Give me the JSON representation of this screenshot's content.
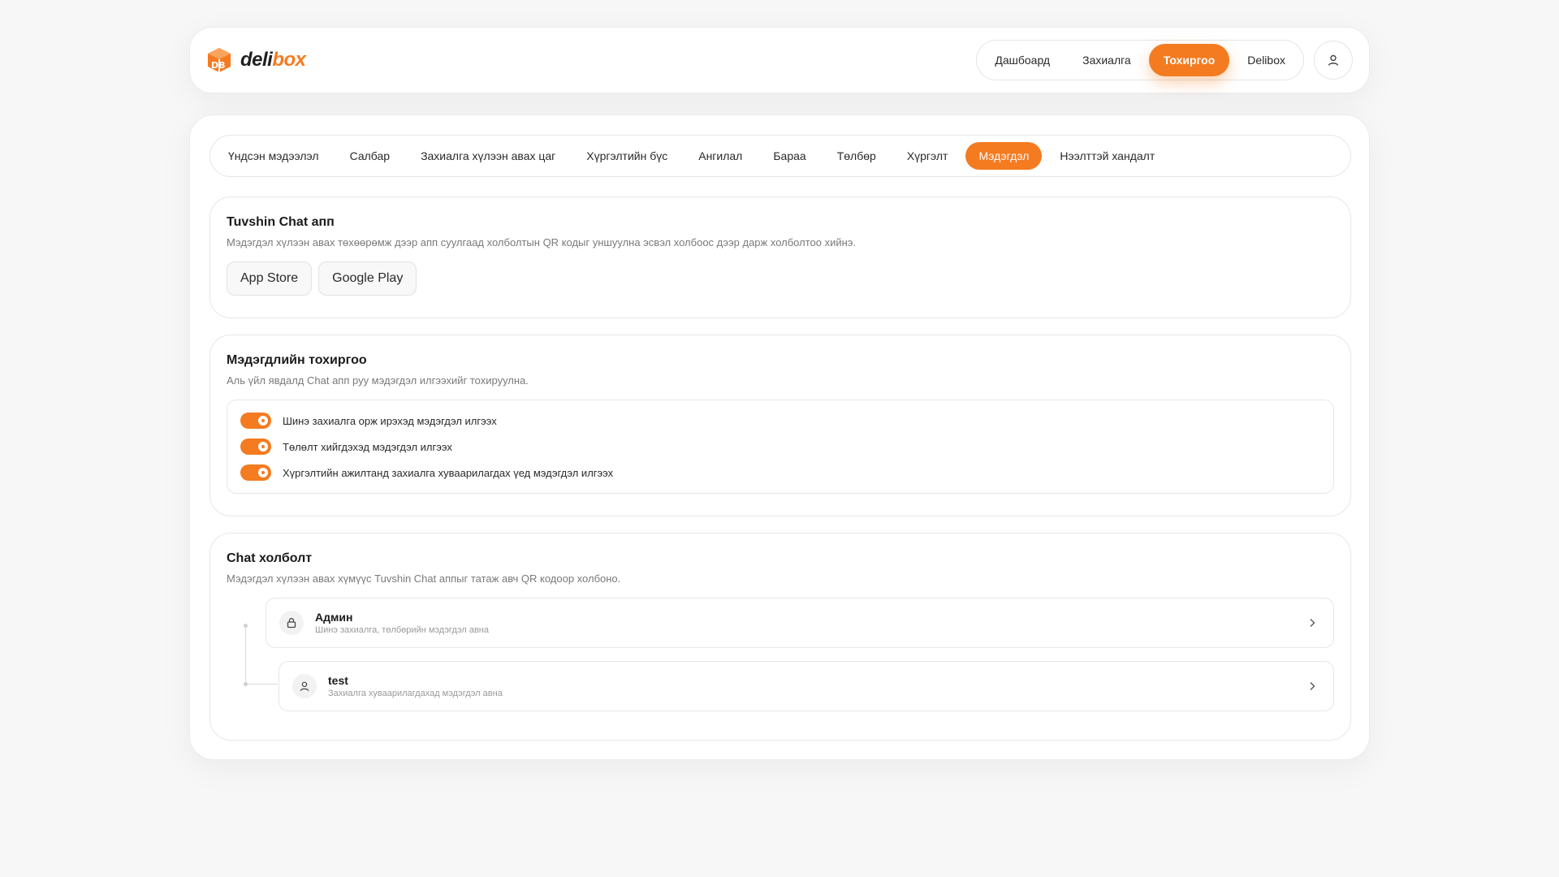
{
  "brand": {
    "name_part1": "deli",
    "name_part2": "box",
    "accent": "#f47b20"
  },
  "nav": {
    "items": [
      {
        "label": "Дашбоард",
        "active": false
      },
      {
        "label": "Захиалга",
        "active": false
      },
      {
        "label": "Тохиргоо",
        "active": true
      },
      {
        "label": "Delibox",
        "active": false
      }
    ],
    "user_icon": "user-icon"
  },
  "tabs": [
    {
      "label": "Үндсэн мэдээлэл",
      "active": false
    },
    {
      "label": "Салбар",
      "active": false
    },
    {
      "label": "Захиалга хүлээн авах цаг",
      "active": false
    },
    {
      "label": "Хүргэлтийн бүс",
      "active": false
    },
    {
      "label": "Ангилал",
      "active": false
    },
    {
      "label": "Бараа",
      "active": false
    },
    {
      "label": "Төлбөр",
      "active": false
    },
    {
      "label": "Хүргэлт",
      "active": false
    },
    {
      "label": "Мэдэгдэл",
      "active": true
    },
    {
      "label": "Нээлттэй хандалт",
      "active": false
    }
  ],
  "chat_app": {
    "title": "Tuvshin Chat апп",
    "description": "Мэдэгдэл хүлээн авах төхөөрөмж дээр апп суулгаад холболтын QR кодыг уншуулна эсвэл холбоос дээр дарж холболтоо хийнэ.",
    "app_store": "App Store",
    "google_play": "Google Play"
  },
  "notification_settings": {
    "title": "Мэдэгдлийн тохиргоо",
    "description": "Аль үйл явдалд Chat апп руу мэдэгдэл илгээхийг тохируулна.",
    "toggles": [
      {
        "label": "Шинэ захиалга орж ирэхэд мэдэгдэл илгээх",
        "on": true
      },
      {
        "label": "Төлөлт хийгдэхэд мэдэгдэл илгээх",
        "on": true
      },
      {
        "label": "Хүргэлтийн ажилтанд захиалга хуваарилагдах үед мэдэгдэл илгээх",
        "on": true
      }
    ]
  },
  "chat_connection": {
    "title": "Chat холболт",
    "description": "Мэдэгдэл хүлээн авах хүмүүс Tuvshin Chat аппыг татаж авч QR кодоор холбоно.",
    "contacts": [
      {
        "name": "Админ",
        "subtitle": "Шинэ захиалга, төлбөрийн мэдэгдэл авна",
        "icon": "lock-icon"
      },
      {
        "name": "test",
        "subtitle": "Захиалга хуваарилагдахад мэдэгдэл авна",
        "icon": "user-icon"
      }
    ]
  }
}
